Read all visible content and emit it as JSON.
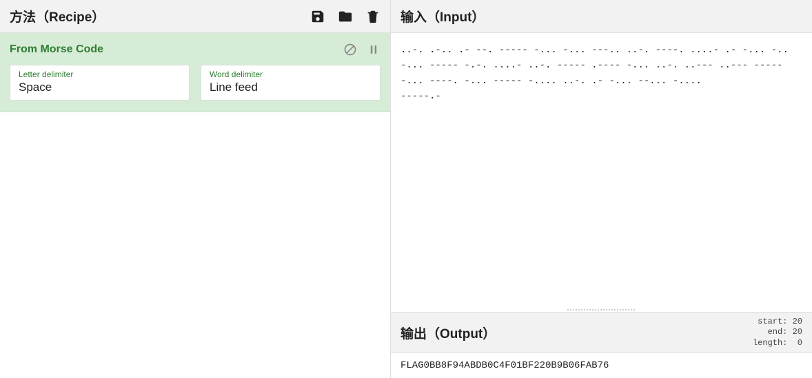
{
  "recipe": {
    "title": "方法（Recipe）",
    "operation": {
      "name": "From Morse Code",
      "args": {
        "letter_delimiter": {
          "label": "Letter delimiter",
          "value": "Space"
        },
        "word_delimiter": {
          "label": "Word delimiter",
          "value": "Line feed"
        }
      }
    }
  },
  "input": {
    "title": "输入（Input）",
    "text": "..-. .-.. .- --. ----- -... -... ---.. ..-. ----. ....- .- -... -.. -... ----- -.-. ....- ..-. ----- .---- -... ..-. ..--- ..--- ----- -... ----. -... ----- -.... ..-. .- -... --... -....\n-----.-"
  },
  "output": {
    "title": "输出（Output）",
    "meta": {
      "start_label": "start:",
      "start_value": "20",
      "end_label": "end:",
      "end_value": "20",
      "length_label": "length:",
      "length_value": "0"
    },
    "text": "FLAG0BB8F94ABDB0C4F01BF220B9B06FAB76"
  }
}
